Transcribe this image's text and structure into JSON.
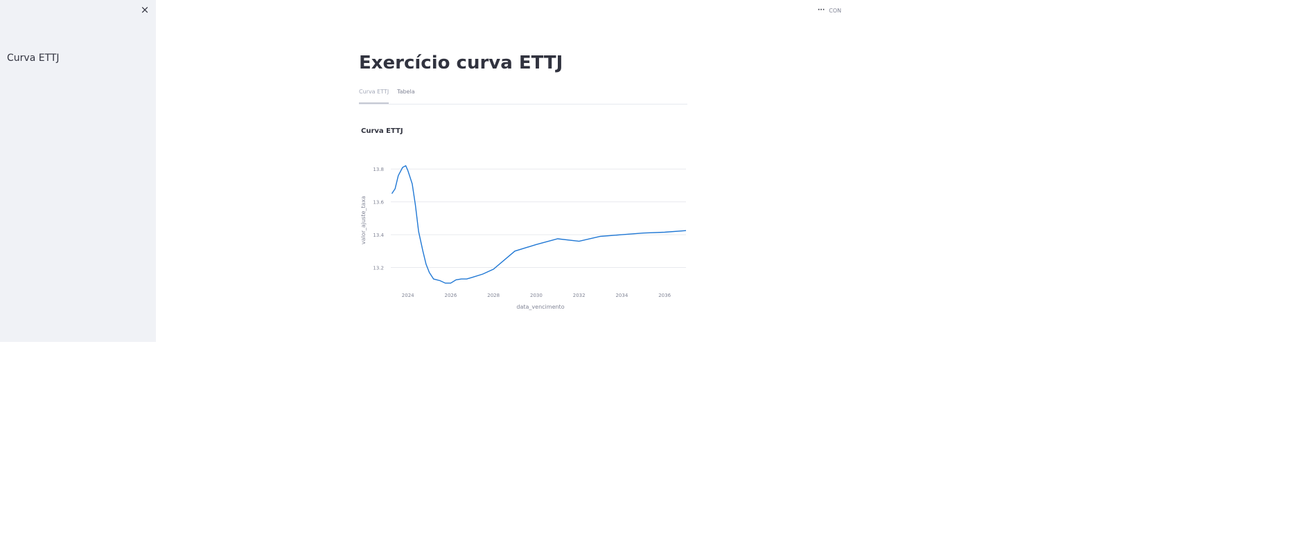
{
  "sidebar": {
    "close_icon": "×",
    "items": [
      {
        "label": "Curva ETTJ"
      }
    ]
  },
  "menu": {
    "dots": "···",
    "status": "CON"
  },
  "main": {
    "title": "Exercício curva ETTJ",
    "tabs": [
      {
        "label": "Curva ETTJ",
        "active": true
      },
      {
        "label": "Tabela",
        "active": false
      }
    ]
  },
  "colors": {
    "line": "#1f77d4",
    "grid": "#e8eaee",
    "tick_text": "#808495",
    "sidebar_bg": "#f0f2f6",
    "text": "#31333f"
  },
  "chart_data": {
    "type": "line",
    "title": "Curva ETTJ",
    "xlabel": "data_vencimento",
    "ylabel": "valor_ajuste_taxa",
    "xlim": [
      2023.2,
      2037.0
    ],
    "ylim": [
      13.08,
      13.86
    ],
    "xticks": [
      2024,
      2026,
      2028,
      2030,
      2032,
      2034,
      2036
    ],
    "yticks": [
      13.2,
      13.4,
      13.6,
      13.8
    ],
    "grid": true,
    "legend": "none",
    "x": [
      2023.25,
      2023.4,
      2023.55,
      2023.75,
      2023.9,
      2024.0,
      2024.2,
      2024.35,
      2024.5,
      2024.7,
      2024.85,
      2025.0,
      2025.2,
      2025.5,
      2025.75,
      2026.0,
      2026.25,
      2026.5,
      2026.75,
      2027.0,
      2027.5,
      2028.0,
      2029.0,
      2030.0,
      2031.0,
      2032.0,
      2033.0,
      2034.0,
      2035.0,
      2036.0,
      2037.0
    ],
    "y": [
      13.65,
      13.68,
      13.76,
      13.81,
      13.82,
      13.79,
      13.71,
      13.58,
      13.42,
      13.3,
      13.22,
      13.17,
      13.13,
      13.12,
      13.105,
      13.105,
      13.125,
      13.13,
      13.13,
      13.14,
      13.16,
      13.19,
      13.3,
      13.34,
      13.375,
      13.36,
      13.39,
      13.4,
      13.41,
      13.415,
      13.425
    ]
  }
}
